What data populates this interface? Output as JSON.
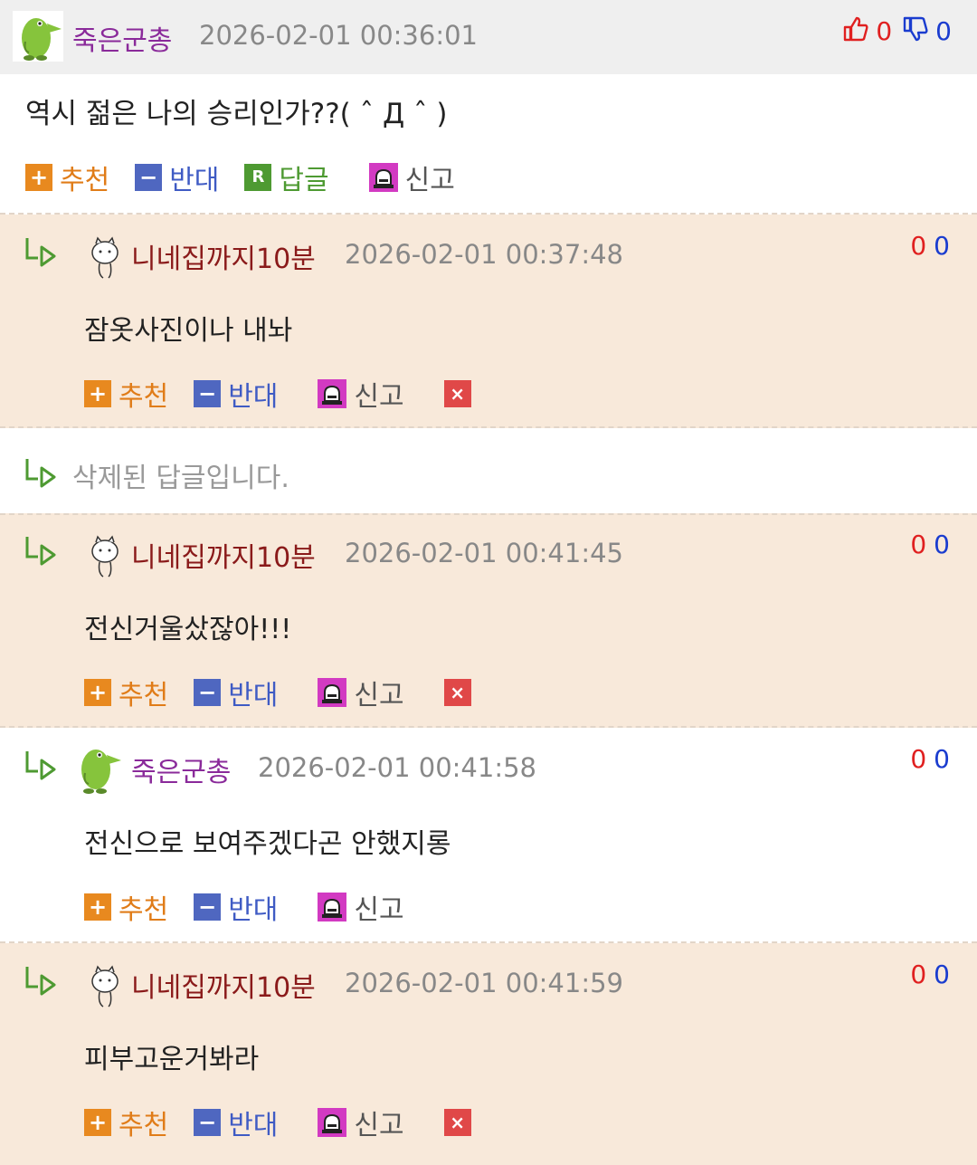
{
  "main_comment": {
    "nickname": "죽은군총",
    "timestamp": "2026-02-01 00:36:01",
    "upvotes": "0",
    "downvotes": "0",
    "text": "역시 젊은 나의 승리인가??( ˆ Д ˆ )",
    "actions": {
      "recommend": "추천",
      "oppose": "반대",
      "reply": "답글",
      "report": "신고"
    },
    "reply_icon_letter": "R"
  },
  "replies": [
    {
      "nickname": "니네집까지10분",
      "timestamp": "2026-02-01 00:37:48",
      "upvotes": "0",
      "downvotes": "0",
      "text": "잠옷사진이나 내놔",
      "actions": {
        "recommend": "추천",
        "oppose": "반대",
        "report": "신고"
      }
    },
    {
      "nickname": "니네집까지10분",
      "timestamp": "2026-02-01 00:41:45",
      "upvotes": "0",
      "downvotes": "0",
      "text": "전신거울샀잖아!!!",
      "actions": {
        "recommend": "추천",
        "oppose": "반대",
        "report": "신고"
      }
    },
    {
      "nickname": "죽은군총",
      "timestamp": "2026-02-01 00:41:58",
      "upvotes": "0",
      "downvotes": "0",
      "text": "전신으로 보여주겠다곤 안했지롱",
      "actions": {
        "recommend": "추천",
        "oppose": "반대",
        "report": "신고"
      }
    },
    {
      "nickname": "니네집까지10분",
      "timestamp": "2026-02-01 00:41:59",
      "upvotes": "0",
      "downvotes": "0",
      "text": "피부고운거봐라",
      "actions": {
        "recommend": "추천",
        "oppose": "반대",
        "report": "신고"
      }
    }
  ],
  "deleted_reply_text": "삭제된 답글입니다.",
  "icons": {
    "plus": "+",
    "minus": "−",
    "delete": "×"
  },
  "colors": {
    "reply_bg": "#f8e9da",
    "header_bg": "#efefef",
    "upvote": "#e02020",
    "downvote": "#1a3ccf"
  }
}
